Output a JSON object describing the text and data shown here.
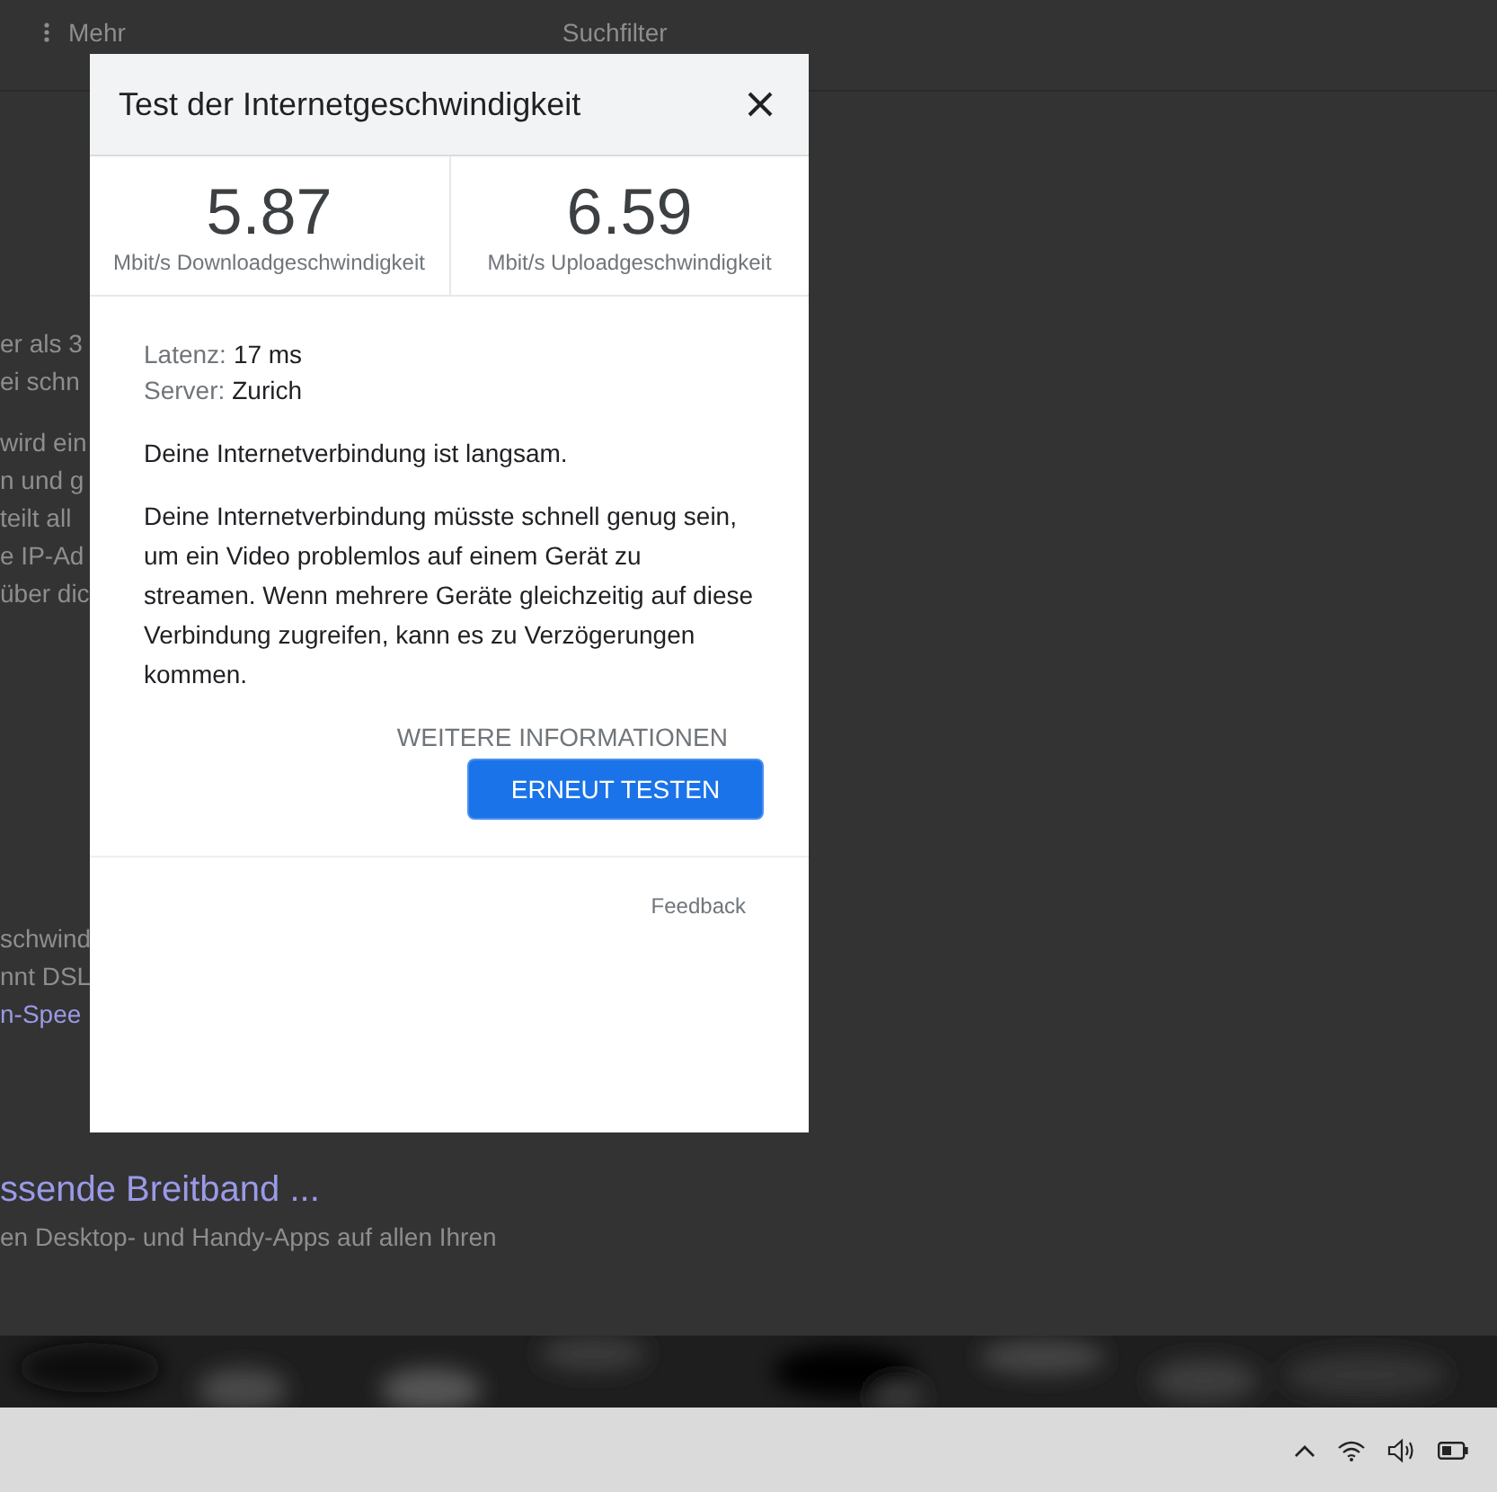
{
  "page": {
    "toolbar": {
      "more_label": "Mehr",
      "filter_label": "Suchfilter"
    },
    "snippet_groups": [
      {
        "lines": [
          {
            "text": "er als 3",
            "kind": "text"
          },
          {
            "text": "ei schn",
            "kind": "text"
          }
        ]
      },
      {
        "lines": [
          {
            "text": "wird ein",
            "kind": "text"
          },
          {
            "text": "n und g",
            "kind": "text"
          },
          {
            "text": "teilt all",
            "kind": "text"
          },
          {
            "text": "e IP-Ad",
            "kind": "text"
          },
          {
            "text": "über dic",
            "kind": "text"
          }
        ]
      },
      {
        "lines": [
          {
            "text": "schwind",
            "kind": "text"
          },
          {
            "text": "nnt DSL",
            "kind": "text"
          },
          {
            "text": "n-Spee",
            "kind": "link"
          }
        ]
      }
    ],
    "result_title": "ssende Breitband ...",
    "result_snippet": "en Desktop- und Handy-Apps auf allen Ihren"
  },
  "dialog": {
    "title": "Test der Internetgeschwindigkeit",
    "stats": [
      {
        "value": "5.87",
        "label": "Mbit/s Downloadgeschwindigkeit"
      },
      {
        "value": "6.59",
        "label": "Mbit/s Uploadgeschwindigkeit"
      }
    ],
    "details": [
      {
        "label": "Latenz:",
        "value": "17 ms"
      },
      {
        "label": "Server:",
        "value": "Zurich"
      }
    ],
    "summary": "Deine Internetverbindung ist langsam.",
    "description": "Deine Internetverbindung müsste schnell genug sein, um ein Video problemlos auf einem Gerät zu streamen. Wenn mehrere Geräte gleichzeitig auf diese Verbindung zugreifen, kann es zu Verzögerungen kommen.",
    "more_info": "WEITERE INFORMATIONEN",
    "retest_button": "ERNEUT TESTEN",
    "feedback": "Feedback"
  }
}
